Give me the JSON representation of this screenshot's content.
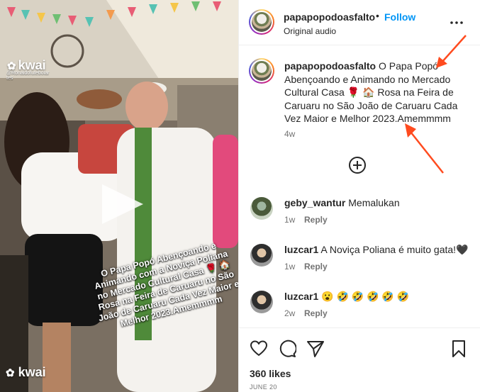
{
  "video": {
    "watermark_logo": "kwai",
    "watermark_handle": "@Ronaldofutebolar",
    "watermark_handle_2": "tes",
    "watermark_bottom": "kwai",
    "overlay_caption": "O Papa Popó Abençoando e Animando com a Noviça Poliana no Mercado Cultural Casa 🌹 🏠 Rosa na Feira de Caruaru no São João de Caruaru Cada Vez Maior e Melhor 2023.Amemmmm"
  },
  "header": {
    "username": "papapopodoasfalto",
    "separator": "•",
    "follow_label": "Follow",
    "subtitle": "Original audio"
  },
  "caption": {
    "username": "papapopodoasfalto",
    "text": "O Papa Popó Abençoando e Animando no Mercado Cultural Casa 🌹 🏠 Rosa na Feira de Caruaru no São João de Caruaru Cada Vez Maior e Melhor 2023.Amemmmm",
    "time": "4w"
  },
  "comments": [
    {
      "username": "geby_wantur",
      "text": "Memalukan",
      "time": "1w",
      "reply_label": "Reply"
    },
    {
      "username": "luzcar1",
      "text": "A Noviça Poliana é muito gata!🖤",
      "time": "1w",
      "reply_label": "Reply"
    },
    {
      "username": "luzcar1",
      "text": "😮 🤣 🤣 🤣 🤣 🤣",
      "time": "2w",
      "reply_label": "Reply"
    }
  ],
  "footer": {
    "likes": "360 likes",
    "date": "JUNE 20"
  },
  "icons": {
    "more": "more-options-icon",
    "add_comment": "add-circle-icon",
    "like": "heart-icon",
    "comment": "comment-icon",
    "share": "share-icon",
    "save": "bookmark-icon",
    "play": "play-icon"
  },
  "colors": {
    "follow": "#0095f6",
    "muted": "#737373",
    "annotation_arrow": "#ff4b1f"
  }
}
